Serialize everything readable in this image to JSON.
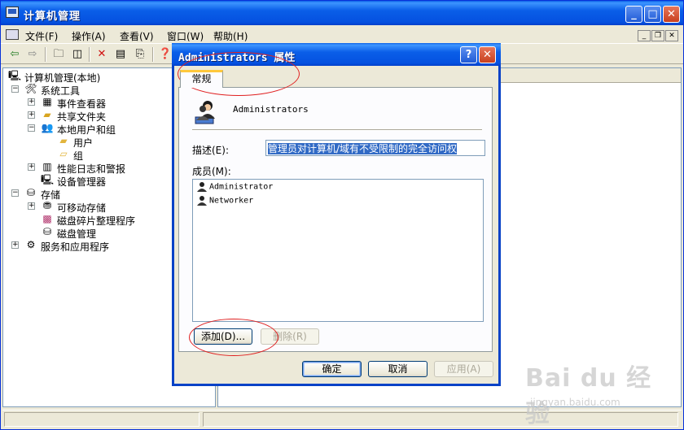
{
  "main_window": {
    "title": "计算机管理",
    "menu": [
      "文件(F)",
      "操作(A)",
      "查看(V)",
      "窗口(W)",
      "帮助(H)"
    ]
  },
  "tree": {
    "items": [
      {
        "label": "计算机管理(本地)",
        "icon": "computer-icon",
        "expander": ""
      },
      {
        "label": "系统工具",
        "icon": "tools-icon",
        "expander": "−"
      },
      {
        "label": "事件查看器",
        "icon": "event-viewer-icon",
        "expander": "+"
      },
      {
        "label": "共享文件夹",
        "icon": "shared-folder-icon",
        "expander": "+"
      },
      {
        "label": "本地用户和组",
        "icon": "users-icon",
        "expander": "−"
      },
      {
        "label": "用户",
        "icon": "folder-icon",
        "expander": ""
      },
      {
        "label": "组",
        "icon": "folder-open-icon",
        "expander": ""
      },
      {
        "label": "性能日志和警报",
        "icon": "performance-icon",
        "expander": "+"
      },
      {
        "label": "设备管理器",
        "icon": "device-manager-icon",
        "expander": ""
      },
      {
        "label": "存储",
        "icon": "storage-icon",
        "expander": "−"
      },
      {
        "label": "可移动存储",
        "icon": "removable-storage-icon",
        "expander": "+"
      },
      {
        "label": "磁盘碎片整理程序",
        "icon": "defrag-icon",
        "expander": ""
      },
      {
        "label": "磁盘管理",
        "icon": "disk-management-icon",
        "expander": ""
      },
      {
        "label": "服务和应用程序",
        "icon": "services-icon",
        "expander": "+"
      }
    ]
  },
  "dialog": {
    "title": "Administrators 属性",
    "help_glyph": "?",
    "close_glyph": "✕",
    "tab_general": "常规",
    "group_name": "Administrators",
    "description_label": "描述(E):",
    "description_value": "管理员对计算机/域有不受限制的完全访问权",
    "members_label": "成员(M):",
    "members": [
      "Administrator",
      "Networker"
    ],
    "add_button": "添加(D)...",
    "remove_button": "删除(R)",
    "ok_button": "确定",
    "cancel_button": "取消",
    "apply_button": "应用(A)"
  },
  "watermark": {
    "main": "Bai du 经验",
    "sub": "jingyan.baidu.com"
  }
}
